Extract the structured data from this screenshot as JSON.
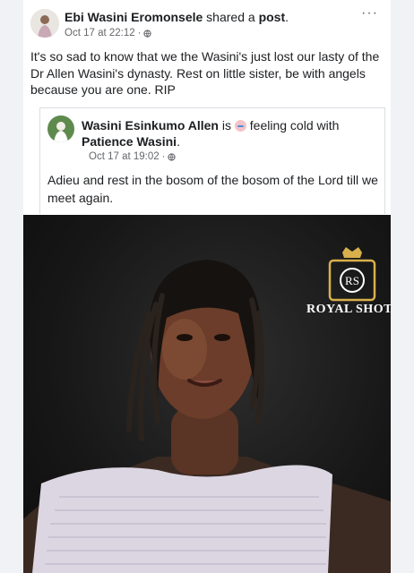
{
  "post": {
    "author": "Ebi Wasini Eromonsele",
    "action_text": " shared a ",
    "action_link": "post",
    "action_end": ".",
    "timestamp": "Oct 17 at 22:12",
    "separator": "·",
    "body": "It's so sad to know that we the Wasini's just lost our lasty of the Dr Allen Wasini's dynasty.  Rest on little sister,  be with angels because you are one.  RIP",
    "more_label": "···"
  },
  "shared": {
    "author": "Wasini Esinkumo Allen",
    "is_text": " is ",
    "feeling_text": " feeling cold with ",
    "tagged": "Patience Wasini",
    "tagged_end": ".",
    "timestamp": "Oct 17 at 19:02",
    "separator": "·",
    "body": "Adieu and rest in the bosom of the bosom of the Lord till we meet again."
  },
  "photo": {
    "watermark_monogram": "RS",
    "watermark_text": "ROYAL SHOT"
  },
  "icons": {
    "feeling": "cold-face-emoji-icon",
    "privacy": "globe-icon"
  }
}
